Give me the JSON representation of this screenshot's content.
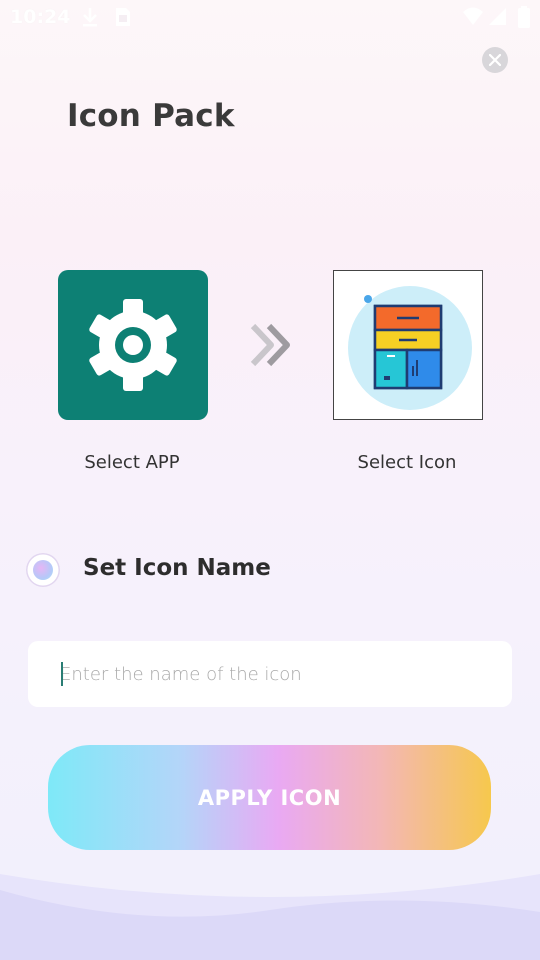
{
  "status_bar": {
    "time": "10:24",
    "icons": [
      "download-icon",
      "sim-card-icon",
      "wifi-icon",
      "signal-icon",
      "battery-icon"
    ]
  },
  "header": {
    "title": "Icon Pack",
    "close_icon": "close-icon"
  },
  "picker": {
    "app_label": "Select APP",
    "icon_label": "Select Icon",
    "app_icon": "gear-icon",
    "arrow_icon": "double-chevron-right-icon",
    "selected_icon": "cabinet-icon",
    "app_tile_color": "#0d8074"
  },
  "name_section": {
    "title": "Set Icon Name",
    "input_placeholder": "Enter the name of the icon",
    "input_value": ""
  },
  "apply": {
    "label": "APPLY ICON"
  }
}
